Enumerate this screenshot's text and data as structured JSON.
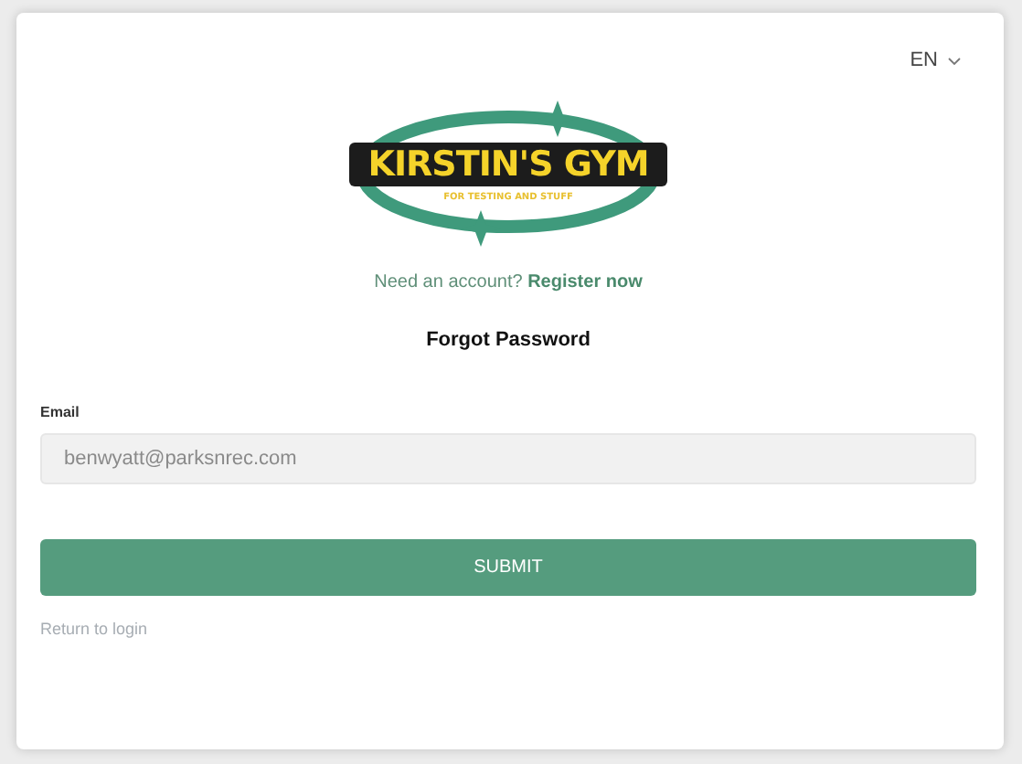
{
  "language_selector": {
    "value": "EN"
  },
  "logo": {
    "title": "KIRSTIN'S GYM",
    "tagline": "FOR TESTING AND STUFF"
  },
  "register_prompt": {
    "text": "Need an account?",
    "link": "Register now"
  },
  "heading": "Forgot Password",
  "email_field": {
    "label": "Email",
    "placeholder": "benwyatt@parksnrec.com"
  },
  "submit_button": "SUBMIT",
  "return_link": "Return to login"
}
